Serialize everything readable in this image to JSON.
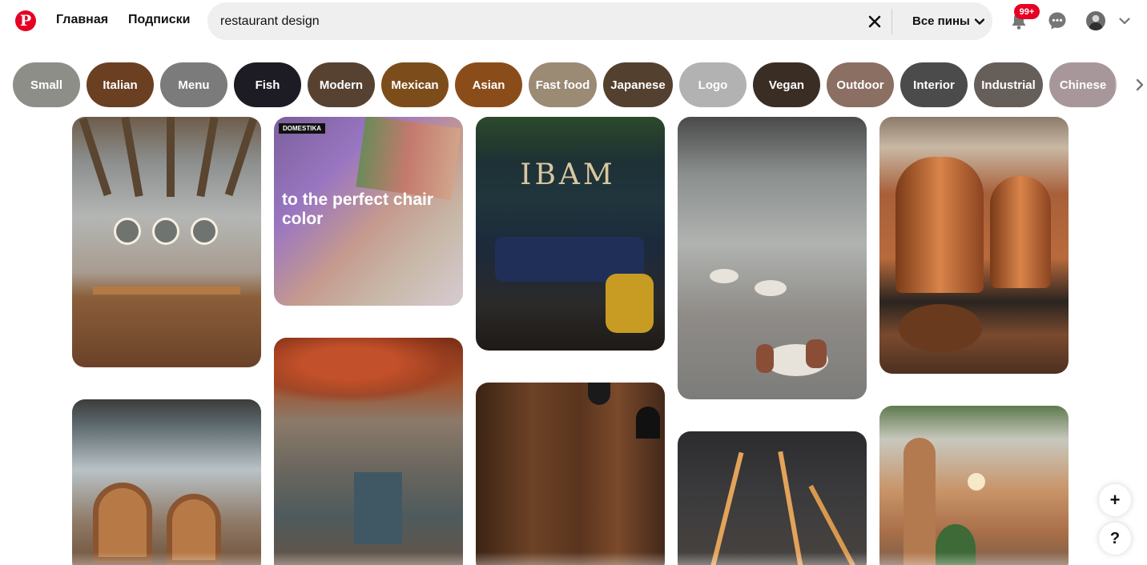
{
  "header": {
    "logo_icon": "pinterest-logo",
    "home_label": "Главная",
    "following_label": "Подписки",
    "search_value": "restaurant design",
    "scope_label": "Все пины",
    "notifications_badge": "99+",
    "icons": [
      "pinterest-logo",
      "close-icon",
      "chevron-down-icon",
      "bell-icon",
      "chat-icon",
      "avatar",
      "chevron-down-icon"
    ]
  },
  "chips": [
    {
      "label": "Small",
      "color": "#8c8e87"
    },
    {
      "label": "Italian",
      "color": "#6b3f22"
    },
    {
      "label": "Menu",
      "color": "#7b7b7c"
    },
    {
      "label": "Fish",
      "color": "#1d1c24"
    },
    {
      "label": "Modern",
      "color": "#574232"
    },
    {
      "label": "Mexican",
      "color": "#7c4d1b"
    },
    {
      "label": "Asian",
      "color": "#8a4d1a"
    },
    {
      "label": "Fast food",
      "color": "#9b8a74"
    },
    {
      "label": "Japanese",
      "color": "#54402f"
    },
    {
      "label": "Logo",
      "color": "#b2b2b2"
    },
    {
      "label": "Vegan",
      "color": "#3a2e24"
    },
    {
      "label": "Outdoor",
      "color": "#8b6f62"
    },
    {
      "label": "Interior",
      "color": "#4b4b4b"
    },
    {
      "label": "Industrial",
      "color": "#665e59"
    },
    {
      "label": "Chinese",
      "color": "#a8979a"
    }
  ],
  "pins": [
    {
      "name": "pin-restroom-sinks"
    },
    {
      "name": "pin-chair-color",
      "overlay_text": "to the perfect chair color",
      "brand_tag": "DOMESTIKA"
    },
    {
      "name": "pin-ibam-lounge",
      "sign_text": "IBAM"
    },
    {
      "name": "pin-concrete-cafe"
    },
    {
      "name": "pin-copper-ovens"
    },
    {
      "name": "pin-pod-booths"
    },
    {
      "name": "pin-autumn-dining"
    },
    {
      "name": "pin-wood-wall"
    },
    {
      "name": "pin-linear-lights"
    },
    {
      "name": "pin-arch-plants"
    }
  ],
  "floating": {
    "add_label": "+",
    "help_label": "?"
  }
}
